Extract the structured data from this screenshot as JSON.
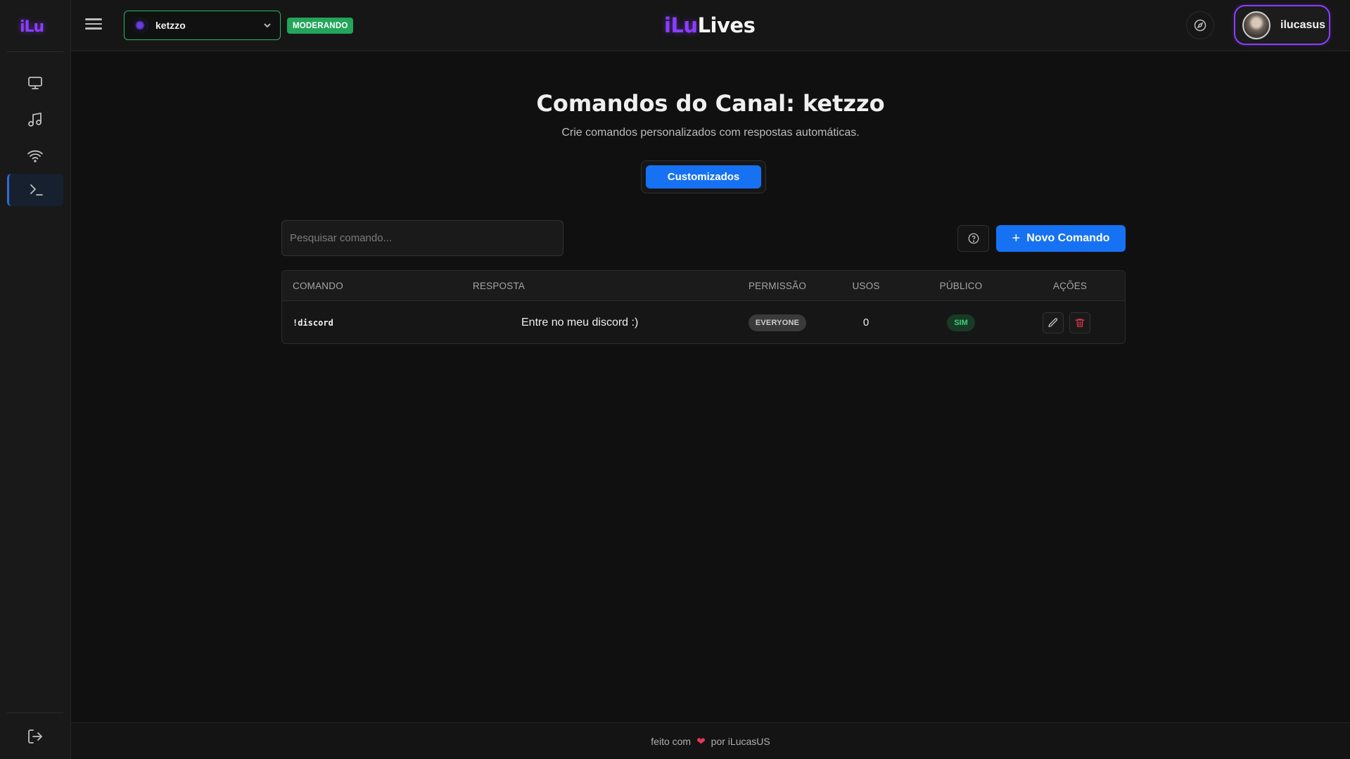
{
  "app": {
    "logo_text": "iLu",
    "brand_part1": "iLu",
    "brand_part2": "Lives"
  },
  "sidebar": {
    "items": [
      {
        "name": "monitor-icon",
        "active": false
      },
      {
        "name": "music-icon",
        "active": false
      },
      {
        "name": "wifi-icon",
        "active": false
      },
      {
        "name": "terminal-icon",
        "active": true
      }
    ],
    "bottom_icon": "logout-icon"
  },
  "header": {
    "channel": {
      "name": "ketzzo",
      "chevron": "chevron-down-icon"
    },
    "role_badge": "MODERANDO",
    "compass_icon": "compass-icon",
    "user": {
      "name": "ilucasus"
    }
  },
  "main": {
    "title": "Comandos do Canal: ketzzo",
    "subtitle": "Crie comandos personalizados com respostas automáticas.",
    "tabs": [
      {
        "label": "Customizados",
        "active": true
      }
    ],
    "search": {
      "placeholder": "Pesquisar comando...",
      "value": ""
    },
    "help_icon": "help-circle-icon",
    "new_button": {
      "icon": "+",
      "label": "Novo Comando"
    },
    "table": {
      "headers": [
        "COMANDO",
        "RESPOSTA",
        "PERMISSÃO",
        "USOS",
        "PÚBLICO",
        "AÇÕES"
      ],
      "rows": [
        {
          "command": "!discord",
          "response": "Entre no meu discord :)",
          "permission": "EVERYONE",
          "uses": "0",
          "public": "SIM"
        }
      ]
    }
  },
  "footer": {
    "before": "feito com",
    "heart": "❤",
    "after": "por iLucasUS"
  },
  "colors": {
    "accent_blue": "#1672f3",
    "brand_purple": "#8b3dff",
    "mod_green": "#23a55a",
    "danger_red": "#e0384a"
  }
}
